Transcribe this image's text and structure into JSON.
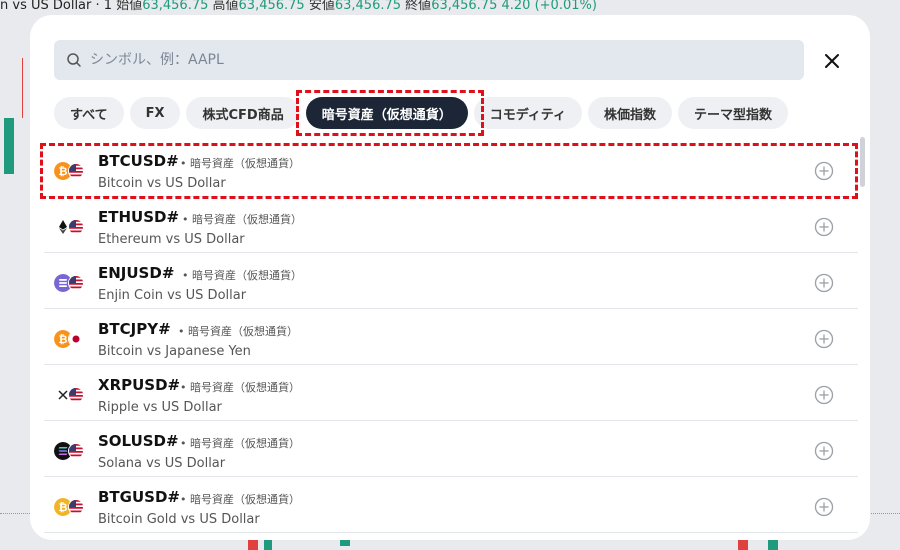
{
  "background": {
    "header": {
      "title": "n vs US Dollar · 1",
      "open_label": "始値",
      "open": "63,456.75",
      "high_label": "高値",
      "high": "63,456.75",
      "low_label": "安値",
      "low": "63,456.75",
      "close_label": "終値",
      "close": "63,456.75",
      "change": "4.20 (+0.01%)"
    }
  },
  "search": {
    "value": "",
    "placeholder": "シンボル、例：AAPL"
  },
  "tabs": [
    {
      "label": "すべて"
    },
    {
      "label": "FX"
    },
    {
      "label": "株式CFD商品"
    },
    {
      "label": "暗号資産（仮想通貨）",
      "active": true
    },
    {
      "label": "コモディティ"
    },
    {
      "label": "株価指数"
    },
    {
      "label": "テーマ型指数"
    }
  ],
  "symbols": [
    {
      "symbol": "BTCUSD#",
      "category": "• 暗号資産（仮想通貨）",
      "description": "Bitcoin vs US Dollar",
      "base_icon": "bitcoin-icon",
      "quote_icon": "us-flag-icon"
    },
    {
      "symbol": "ETHUSD#",
      "category": "• 暗号資産（仮想通貨）",
      "description": "Ethereum vs US Dollar",
      "base_icon": "ethereum-icon",
      "quote_icon": "us-flag-icon"
    },
    {
      "symbol": "ENJUSD#",
      "category": "• 暗号資産（仮想通貨）",
      "description": "Enjin Coin vs US Dollar",
      "base_icon": "enjin-icon",
      "quote_icon": "us-flag-icon"
    },
    {
      "symbol": "BTCJPY#",
      "category": "• 暗号資産（仮想通貨）",
      "description": "Bitcoin vs Japanese Yen",
      "base_icon": "bitcoin-icon",
      "quote_icon": "japan-flag-icon"
    },
    {
      "symbol": "XRPUSD#",
      "category": "• 暗号資産（仮想通貨）",
      "description": "Ripple vs US Dollar",
      "base_icon": "ripple-icon",
      "quote_icon": "us-flag-icon"
    },
    {
      "symbol": "SOLUSD#",
      "category": "• 暗号資産（仮想通貨）",
      "description": "Solana vs US Dollar",
      "base_icon": "solana-icon",
      "quote_icon": "us-flag-icon"
    },
    {
      "symbol": "BTGUSD#",
      "category": "• 暗号資産（仮想通貨）",
      "description": "Bitcoin Gold vs US Dollar",
      "base_icon": "bitcoin-gold-icon",
      "quote_icon": "us-flag-icon"
    }
  ],
  "colors": {
    "active_tab": "#1c2636",
    "highlight": "#e0101a",
    "bitcoin": "#f7931a",
    "up": "#1f9a7d",
    "down": "#e0413f"
  }
}
